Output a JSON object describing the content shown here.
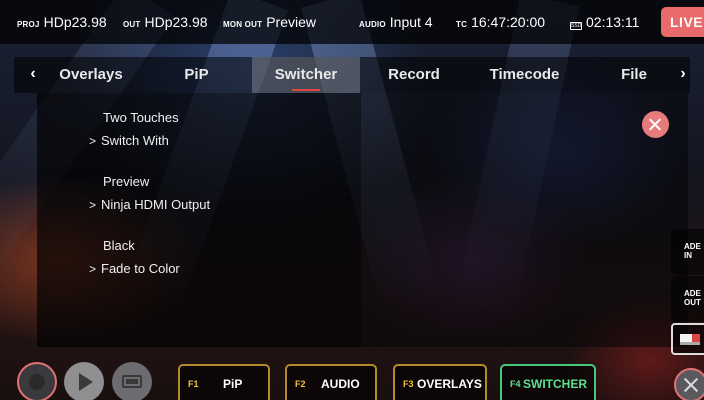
{
  "status": {
    "proj_label": "PROJ",
    "proj_value": "HDp23.98",
    "out_label": "OUT",
    "out_value": "HDp23.98",
    "monout_label": "MON OUT",
    "monout_value": "Preview",
    "audio_label": "AUDIO",
    "audio_value": "Input 4",
    "tc_label": "TC",
    "tc_value": "16:47:20:00",
    "ssd_label": "SSD",
    "ssd_value": "02:13:11",
    "live_label": "LIVE"
  },
  "tabs": [
    {
      "label": "Overlays"
    },
    {
      "label": "PiP"
    },
    {
      "label": "Switcher"
    },
    {
      "label": "Record"
    },
    {
      "label": "Timecode"
    },
    {
      "label": "File"
    }
  ],
  "active_tab": "Switcher",
  "menu": [
    {
      "heading": "Two Touches",
      "value": "Switch With"
    },
    {
      "heading": "Preview",
      "value": "Ninja HDMI Output"
    },
    {
      "heading": "Black",
      "value": "Fade to Color"
    }
  ],
  "side_buttons": {
    "fade_in_line1": "ADE",
    "fade_in_line2": "IN",
    "fade_out_line1": "ADE",
    "fade_out_line2": "OUT"
  },
  "function_keys": [
    {
      "key": "F1",
      "label": "PiP"
    },
    {
      "key": "F2",
      "label": "AUDIO"
    },
    {
      "key": "F3",
      "label": "OVERLAYS"
    },
    {
      "key": "F4",
      "label": "SWITCHER"
    }
  ],
  "colors": {
    "live": "#e86a6a",
    "accent_red": "#e04545",
    "fkey_border": "#b48a2b",
    "fkey_active": "#46c97c",
    "fkey_number": "#f2c23d"
  },
  "icons": {
    "tab_prev": "chevron-left-icon",
    "tab_next": "chevron-right-icon",
    "close": "close-icon",
    "record": "record-icon",
    "play": "play-icon",
    "monitor": "monitor-icon"
  }
}
